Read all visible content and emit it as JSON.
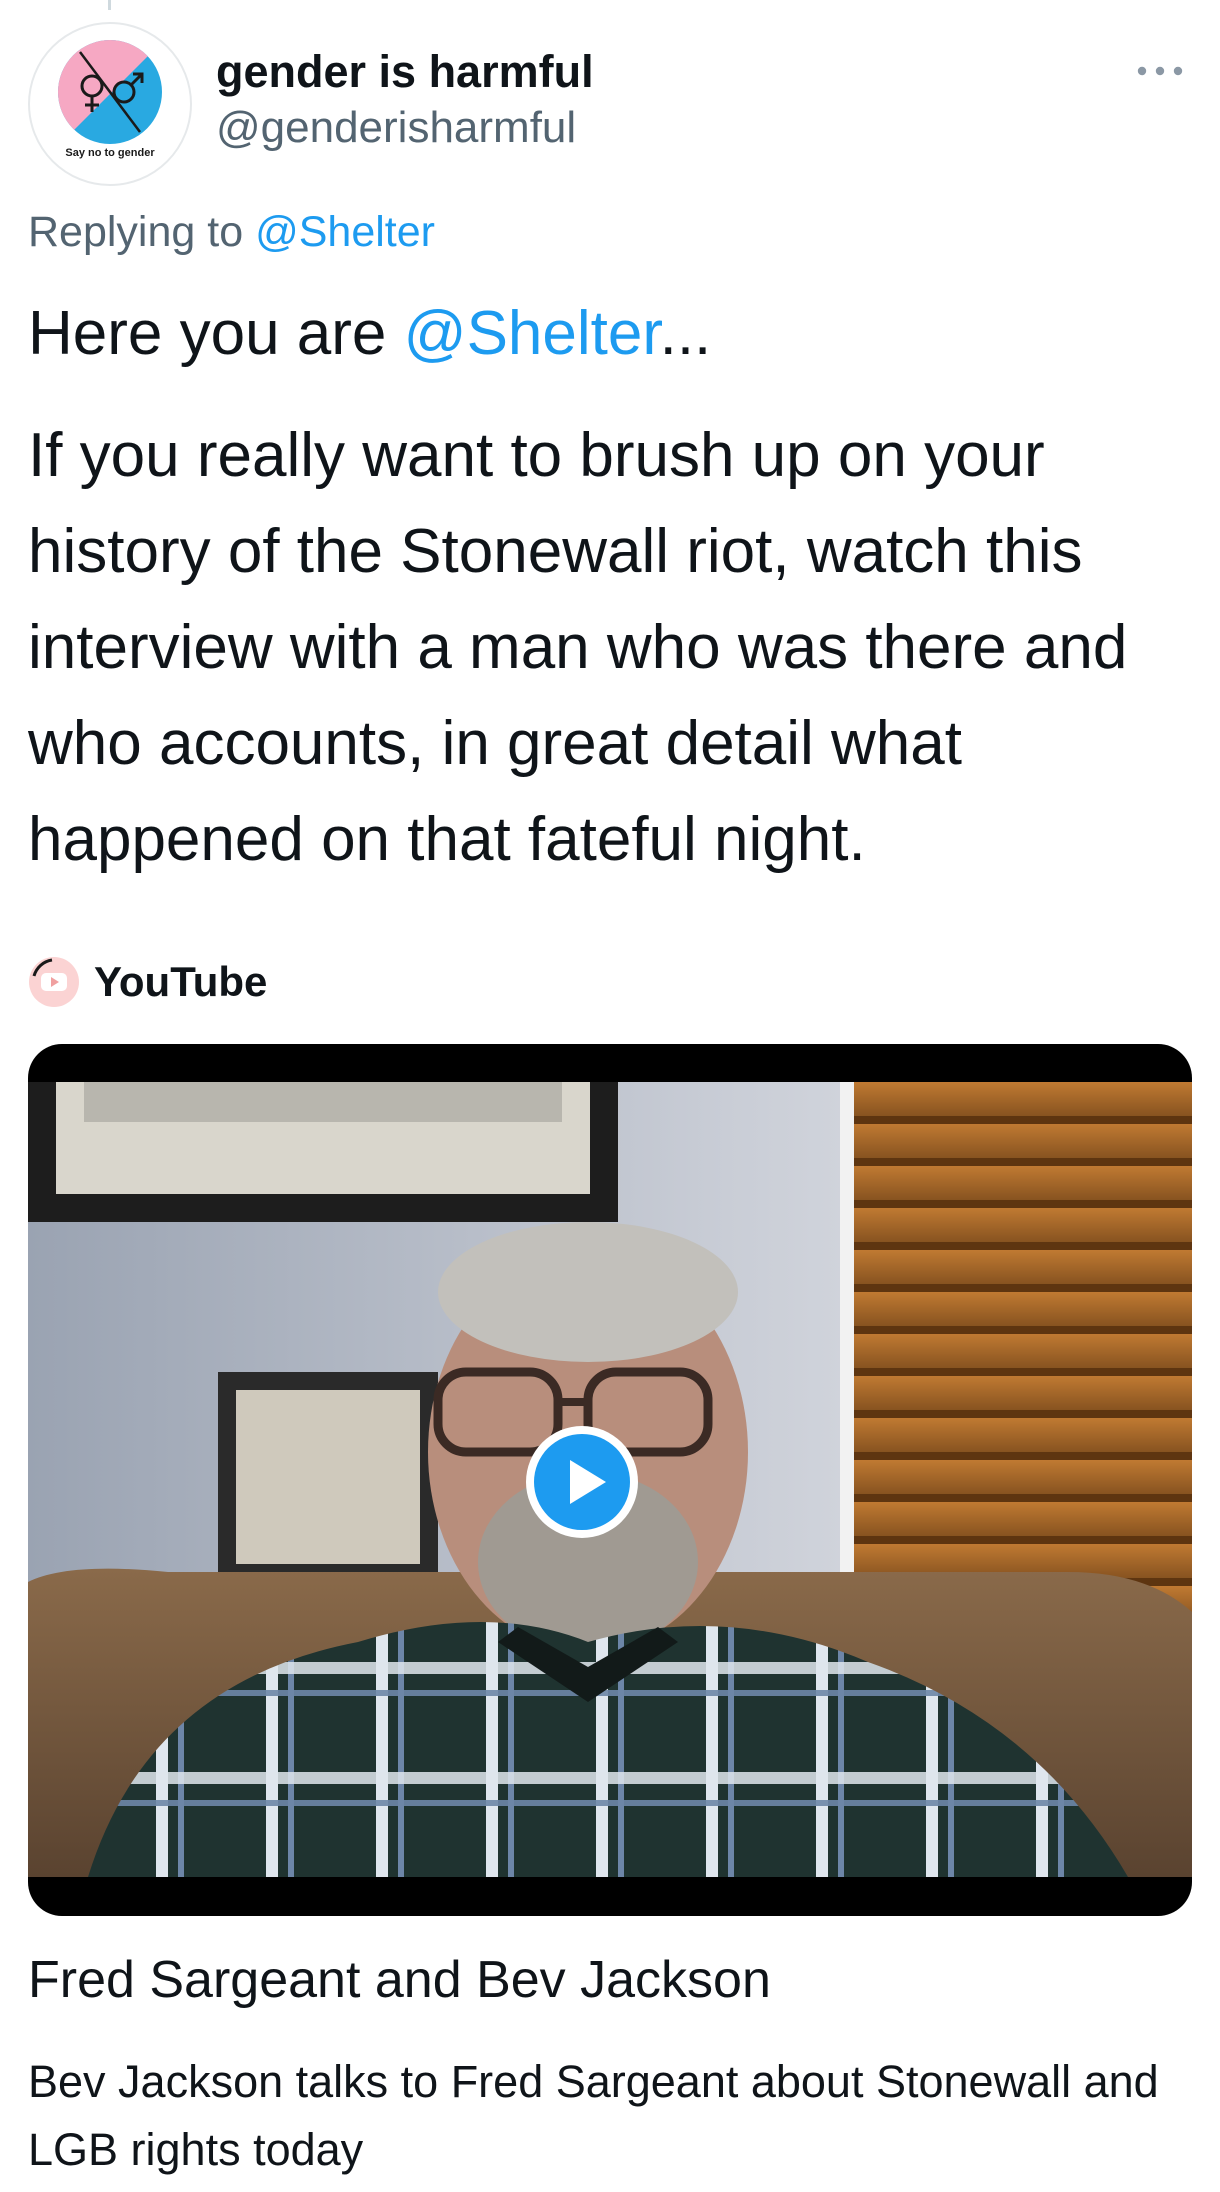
{
  "tweet": {
    "author": {
      "display_name": "gender is harmful",
      "handle": "@genderisharmful",
      "avatar_caption": "Say no to gender"
    },
    "reply_context": {
      "prefix": "Replying to",
      "mention": "@Shelter"
    },
    "text": {
      "line1_prefix": "Here you are ",
      "line1_mention": "@Shelter",
      "line1_suffix": "...",
      "paragraph2": "If you really want to brush up on your history of the Stonewall riot, watch this interview with a man who was there and who accounts, in great detail what happened on that fateful night."
    },
    "more_icon": "more-horizontal-icon"
  },
  "link_card": {
    "source": "YouTube",
    "source_icon": "youtube-icon",
    "play_icon": "play-icon",
    "title": "Fred Sargeant and Bev Jackson",
    "description": "Bev Jackson talks to Fred Sargeant about Stonewall and LGB rights today"
  },
  "colors": {
    "link": "#1d9bf0",
    "secondary_text": "#536471",
    "primary_text": "#0f1419",
    "avatar_pink": "#f6a8c3",
    "avatar_blue": "#29a9e1"
  }
}
